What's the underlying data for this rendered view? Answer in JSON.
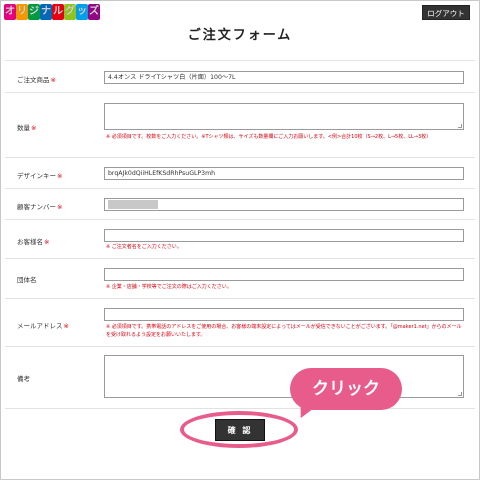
{
  "header": {
    "logo_chars": [
      {
        "char": "オ",
        "color": "#e4007f"
      },
      {
        "char": "リ",
        "color": "#f39800"
      },
      {
        "char": "ジ",
        "color": "#009944"
      },
      {
        "char": "ナ",
        "color": "#0068b7"
      },
      {
        "char": "ル",
        "color": "#e60012"
      },
      {
        "char": "グ",
        "color": "#8fc31f"
      },
      {
        "char": "ッ",
        "color": "#00a0e9"
      },
      {
        "char": "ズ",
        "color": "#920783"
      }
    ],
    "logout_label": "ログアウト",
    "page_title": "ご注文フォーム"
  },
  "form": {
    "product": {
      "label": "ご注文商品",
      "required": "※",
      "value": "4.4オンス ドライTシャツ白（片面）100～7L"
    },
    "quantity": {
      "label": "数量",
      "required": "※",
      "note": "※ 必須項目です。枚数をご入力ください。※Tシャツ類は、サイズも数量欄にご入力お願いします。<例>合計10枚（S→2枚、L→5枚、LL→3枚）"
    },
    "design_key": {
      "label": "デザインキー",
      "required": "※",
      "value": "brqAJk0dQiiHLEfKSdRhPsuGLP3mh"
    },
    "customer_number": {
      "label": "顧客ナンバー",
      "required": "※"
    },
    "customer_name": {
      "label": "お客様名",
      "required": "※",
      "note": "※ ご注文者名をご入力ください。"
    },
    "organization": {
      "label": "団体名",
      "note": "※ 企業・店舗・学校等でご注文の際はご入力ください。"
    },
    "email": {
      "label": "メールアドレス",
      "required": "※",
      "note": "※ 必須項目です。携帯電話のアドレスをご使用の場合、お客様の端末設定によってはメールが受信できないことがございます。「@maker1.net」からのメールを受け取れるよう設定をお願いいたします。"
    },
    "remarks": {
      "label": "備考"
    }
  },
  "confirm_label": "確 認",
  "callout_label": "クリック"
}
